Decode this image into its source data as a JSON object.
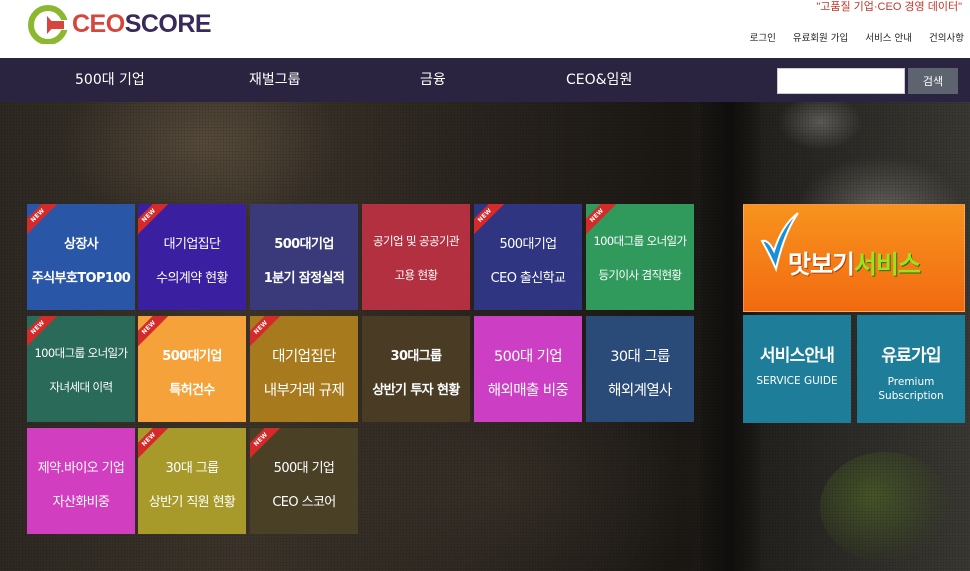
{
  "header": {
    "logo_prefix": "CEO",
    "logo_suffix": "SCORE",
    "slogan": "\"고품질 기업·CEO 경영 데이터\"",
    "top_links": [
      "로그인",
      "유료회원 가입",
      "서비스 안내",
      "건의사항"
    ]
  },
  "nav": {
    "items": [
      "500대 기업",
      "재벌그룹",
      "금융",
      "CEO&임원"
    ],
    "search_placeholder": "",
    "search_label": "검색"
  },
  "ribbon_label": "NEW",
  "tiles": [
    {
      "l1": "상장사",
      "l2": "주식부호TOP100",
      "new": true,
      "color": "#2a56a8"
    },
    {
      "l1": "대기업집단",
      "l2": "수의계약 현황",
      "new": true,
      "color": "#3a1fa0"
    },
    {
      "l1": "500대기업",
      "l2": "1분기 잠정실적",
      "new": false,
      "color": "#3a3a7a"
    },
    {
      "l1": "공기업 및 공공기관",
      "l2": "고용 현황",
      "new": false,
      "color": "#b23040"
    },
    {
      "l1": "500대기업",
      "l2": "CEO 출신학교",
      "new": true,
      "color": "#2f3580"
    },
    {
      "l1": "100대그룹 오너일가",
      "l2": "등기이사 겸직현황",
      "new": true,
      "color": "#2f9a5c"
    },
    {
      "l1": "100대그룹 오너일가",
      "l2": "자녀세대 이력",
      "new": true,
      "color": "#2a6a58"
    },
    {
      "l1": "500대기업",
      "l2": "특허건수",
      "new": true,
      "color": "#f5a23a"
    },
    {
      "l1": "대기업집단",
      "l2": "내부거래 규제",
      "new": true,
      "color": "#a87a1e"
    },
    {
      "l1": "30대그룹",
      "l2": "상반기 투자 현황",
      "new": false,
      "color": "#4a3c24"
    },
    {
      "l1": "500대 기업",
      "l2": "해외매출 비중",
      "new": false,
      "color": "#cc3ec4"
    },
    {
      "l1": "30대 그룹",
      "l2": "해외계열사",
      "new": false,
      "color": "#2a4a78"
    },
    {
      "l1": "제약.바이오 기업",
      "l2": "자산화비중",
      "new": false,
      "color": "#d23ec0"
    },
    {
      "l1": "30대 그룹",
      "l2": "상반기 직원 현황",
      "new": true,
      "color": "#a89a2a"
    },
    {
      "l1": "500대 기업",
      "l2": "CEO 스코어",
      "new": true,
      "color": "#4a4026"
    }
  ],
  "preview": {
    "part1": "맛보기",
    "part2": "서비스"
  },
  "service_guide": {
    "title": "서비스안내",
    "sub": "SERVICE GUIDE"
  },
  "premium": {
    "title": "유료가입",
    "sub1": "Premium",
    "sub2": "Subscription"
  }
}
